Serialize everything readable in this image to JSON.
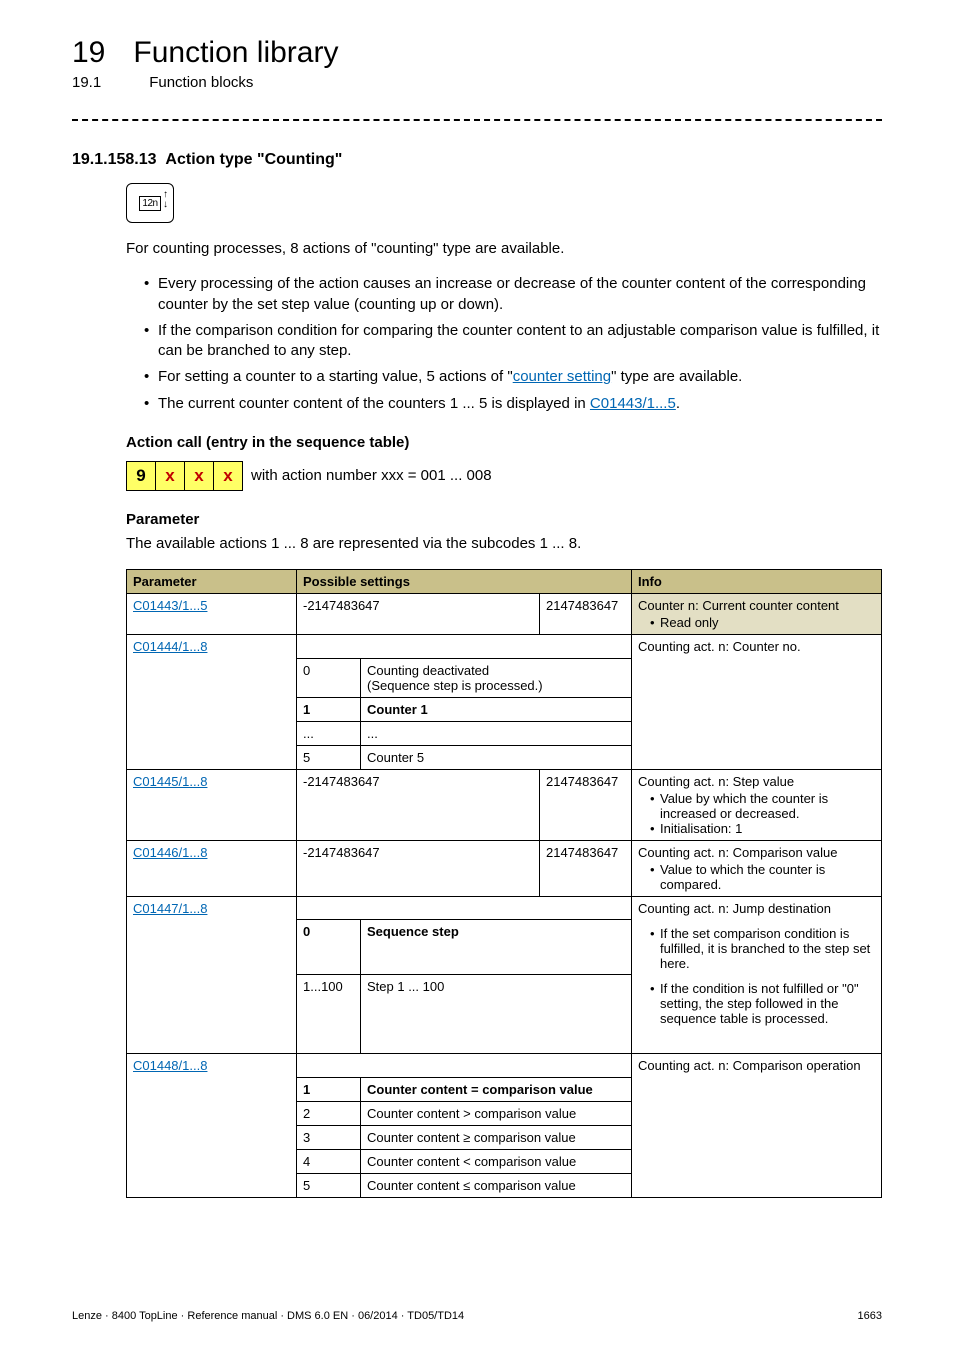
{
  "header": {
    "chapter_number": "19",
    "chapter_title": "Function library",
    "section_number": "19.1",
    "section_title": "Function blocks"
  },
  "section": {
    "number": "19.1.158.13",
    "title": "Action type \"Counting\"",
    "icon_glyph": "12n",
    "intro": "For counting processes, 8 actions of \"counting\" type are available.",
    "bullets": [
      {
        "pre": "Every processing of the action causes an increase or decrease of the counter content of the corresponding counter by the set step value (counting up or down)."
      },
      {
        "pre": "If the comparison condition for comparing the counter content to an adjustable comparison value is fulfilled, it can be branched to any step."
      },
      {
        "pre": "For setting a counter to a starting value, 5 actions of \"",
        "link": "counter setting",
        "post": "\" type are available."
      },
      {
        "pre": "The current counter content of the counters 1 ... 5 is displayed in ",
        "link": "C01443/1...5",
        "post": "."
      }
    ],
    "action_call_heading": "Action call (entry in the sequence table)",
    "action_cells": [
      "9",
      "x",
      "x",
      "x"
    ],
    "action_suffix": "with action number xxx = 001 ... 008",
    "parameter_heading": "Parameter",
    "parameter_intro": "The available actions 1 ... 8 are represented via the subcodes 1 ... 8."
  },
  "table": {
    "headers": {
      "parameter": "Parameter",
      "possible": "Possible settings",
      "info": "Info"
    },
    "rows": {
      "r1": {
        "param_link": "C01443/1...5",
        "min": "-2147483647",
        "max": "2147483647",
        "info_main": "Counter n: Current counter content",
        "info_sub": "Read only"
      },
      "r2": {
        "param_link": "C01444/1...8",
        "opts": [
          {
            "k": "0",
            "v": "Counting deactivated\n(Sequence step is processed.)"
          },
          {
            "k": "1",
            "v": "Counter 1",
            "bold": true
          },
          {
            "k": "...",
            "v": "..."
          },
          {
            "k": "5",
            "v": "Counter 5"
          }
        ],
        "info": "Counting act. n: Counter no."
      },
      "r3": {
        "param_link": "C01445/1...8",
        "min": "-2147483647",
        "max": "2147483647",
        "info_main": "Counting act. n: Step value",
        "info_subs": [
          "Value by which the counter is increased or decreased.",
          "Initialisation: 1"
        ]
      },
      "r4": {
        "param_link": "C01446/1...8",
        "min": "-2147483647",
        "max": "2147483647",
        "info_main": "Counting act. n: Comparison value",
        "info_subs": [
          "Value to which the counter is compared."
        ]
      },
      "r5": {
        "param_link": "C01447/1...8",
        "opts": [
          {
            "k": "0",
            "v": "Sequence step",
            "bold": true
          },
          {
            "k": "1...100",
            "v": "Step 1 ... 100"
          }
        ],
        "info_main": "Counting act. n: Jump destination",
        "info_subs": [
          "If the set comparison condition is fulfilled, it is branched to the step set here.",
          "If the condition is not fulfilled or \"0\" setting, the step followed in the sequence table is processed."
        ]
      },
      "r6": {
        "param_link": "C01448/1...8",
        "opts": [
          {
            "k": "1",
            "v": "Counter content = comparison value",
            "bold": true
          },
          {
            "k": "2",
            "v": "Counter content > comparison value"
          },
          {
            "k": "3",
            "v": "Counter content ≥ comparison value"
          },
          {
            "k": "4",
            "v": "Counter content < comparison value"
          },
          {
            "k": "5",
            "v": "Counter content ≤ comparison value"
          }
        ],
        "info_main": "Counting act. n: Comparison operation"
      }
    }
  },
  "footer": {
    "left": "Lenze · 8400 TopLine · Reference manual · DMS 6.0 EN · 06/2014 · TD05/TD14",
    "right": "1663"
  }
}
